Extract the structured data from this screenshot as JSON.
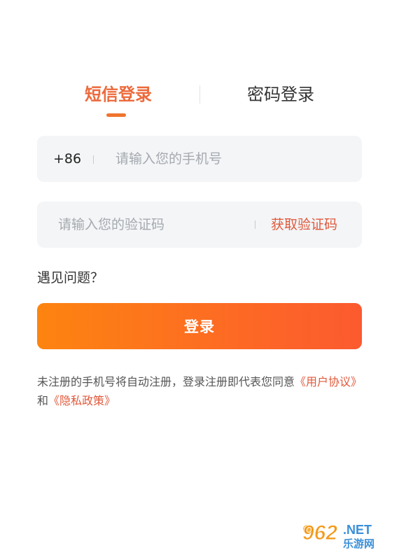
{
  "tabs": {
    "sms_label": "短信登录",
    "password_label": "密码登录"
  },
  "phone": {
    "country_code": "+86",
    "placeholder": "请输入您的手机号"
  },
  "code": {
    "placeholder": "请输入您的验证码",
    "get_code_label": "获取验证码"
  },
  "problem_label": "遇见问题？",
  "login_button_label": "登录",
  "agreement": {
    "prefix": "未注册的手机号将自动注册，登录注册即代表您同意",
    "user_agreement": "《用户协议》",
    "and": "和",
    "privacy_policy": "《隐私政策》"
  },
  "watermark": {
    "number": "962",
    "suffix": ".NET",
    "name": "乐游网"
  },
  "colors": {
    "accent": "#ec6a3c",
    "link": "#e0593b",
    "button_start": "#fd8410",
    "button_end": "#fc5a2f",
    "field_bg": "#f3f5f7"
  }
}
